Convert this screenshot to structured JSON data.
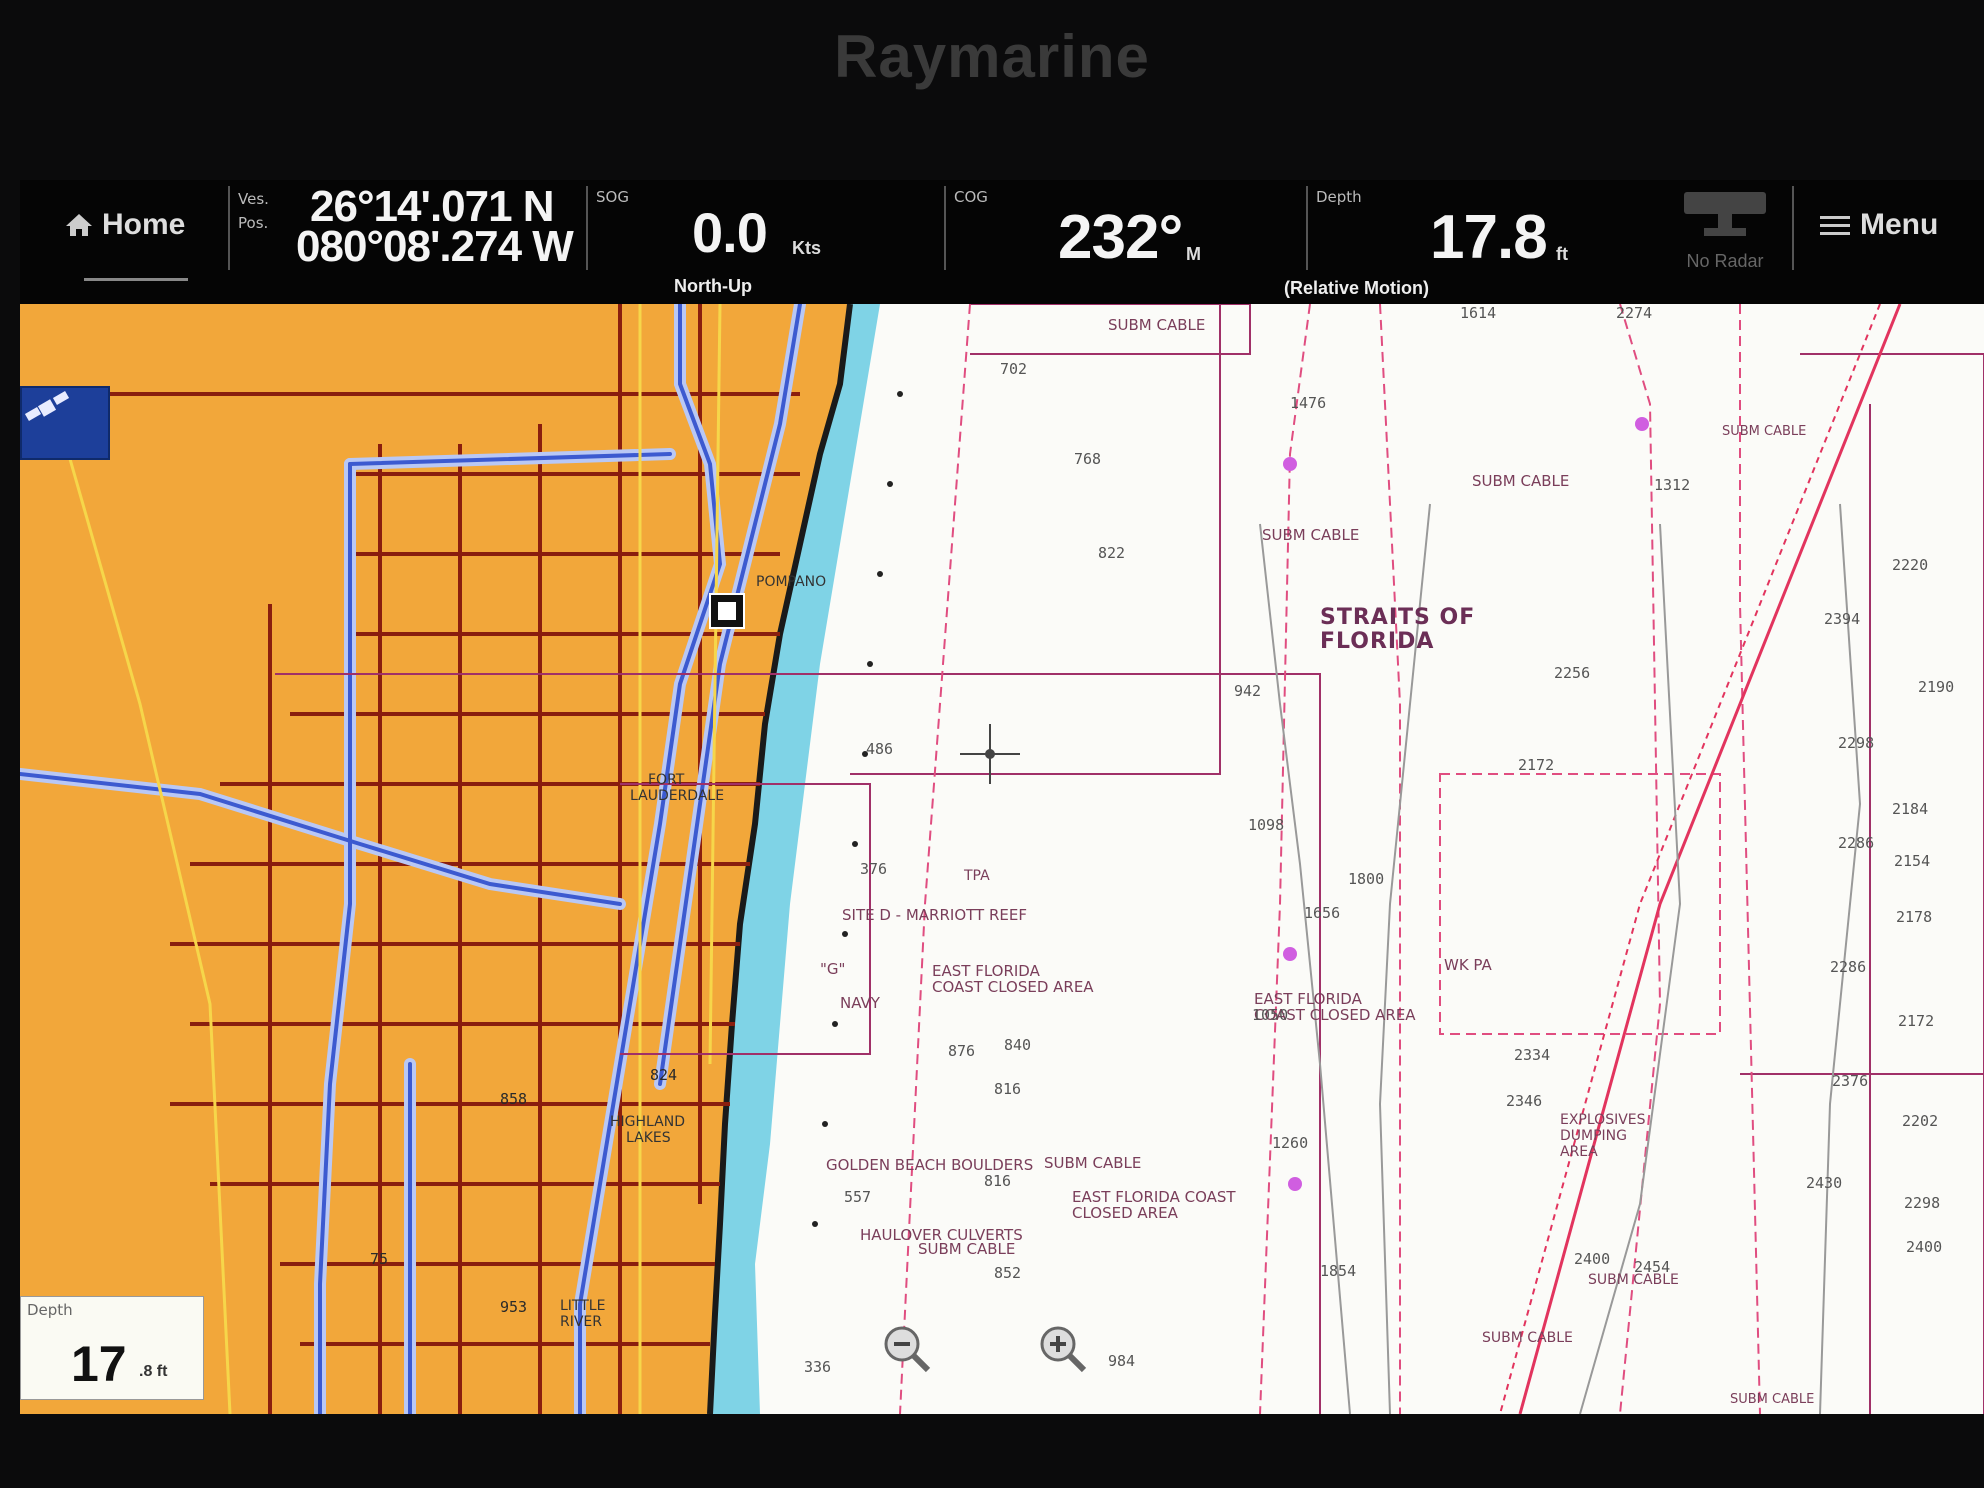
{
  "brand": "Raymarine",
  "databar": {
    "home_label": "Home",
    "position": {
      "label_line1": "Ves.",
      "label_line2": "Pos.",
      "lat": "26°14'.071 N",
      "lon": "080°08'.274 W"
    },
    "sog": {
      "label": "SOG",
      "value": "0.0",
      "unit": "Kts",
      "sub": "North-Up"
    },
    "cog": {
      "label": "COG",
      "value": "232°",
      "unit": "M"
    },
    "depth": {
      "label": "Depth",
      "value": "17.8",
      "unit": "ft",
      "sub": "(Relative Motion)"
    },
    "radar_label": "No Radar",
    "menu_label": "Menu"
  },
  "chart": {
    "depth_box": {
      "label": "Depth",
      "value": "17",
      "unit": ".8 ft"
    },
    "region_label_line1": "STRAITS OF",
    "region_label_line2": "FLORIDA",
    "labels": [
      {
        "text": "SUBM CABLE"
      },
      {
        "text": "SUBM CABLE"
      },
      {
        "text": "SUBM CABLE"
      },
      {
        "text": "SUBM CABLE"
      },
      {
        "text": "SITE D - MARRIOTT REEF"
      },
      {
        "text": "EAST FLORIDA"
      },
      {
        "text": "COAST CLOSED AREA"
      },
      {
        "text": "EAST FLORIDA"
      },
      {
        "text": "COAST CLOSED AREA"
      },
      {
        "text": "NAVY"
      },
      {
        "text": "\"G\""
      },
      {
        "text": "WK PA"
      },
      {
        "text": "EXPLOSIVES"
      },
      {
        "text": "DUMPING"
      },
      {
        "text": "AREA"
      },
      {
        "text": "GOLDEN BEACH BOULDERS"
      },
      {
        "text": "SUBM CABLE"
      },
      {
        "text": "EAST FLORIDA COAST"
      },
      {
        "text": "CLOSED AREA"
      },
      {
        "text": "HAULOVER CULVERTS"
      },
      {
        "text": "SUBM CABLE"
      },
      {
        "text": "SUBM CABLE"
      },
      {
        "text": "SUBM CABLE"
      },
      {
        "text": "SUBM CABLE"
      },
      {
        "text": "POMPANO"
      },
      {
        "text": "FORT"
      },
      {
        "text": "LAUDERDALE"
      },
      {
        "text": "HIGHLAND"
      },
      {
        "text": "LAKES"
      },
      {
        "text": "LITTLE"
      },
      {
        "text": "RIVER"
      },
      {
        "text": "TPA"
      }
    ],
    "soundings": [
      "1614",
      "2274",
      "702",
      "1476",
      "768",
      "1312",
      "822",
      "2220",
      "2394",
      "942",
      "2256",
      "2190",
      "2172",
      "2298",
      "1098",
      "2184",
      "1800",
      "2286",
      "2154",
      "1656",
      "2178",
      "2286",
      "1050",
      "2172",
      "840",
      "876",
      "816",
      "2334",
      "2346",
      "2376",
      "2202",
      "1260",
      "816",
      "2430",
      "2298",
      "557",
      "2400",
      "2454",
      "2400",
      "1854",
      "852",
      "984",
      "336",
      "486",
      "376",
      "824",
      "858",
      "75",
      "953"
    ]
  }
}
